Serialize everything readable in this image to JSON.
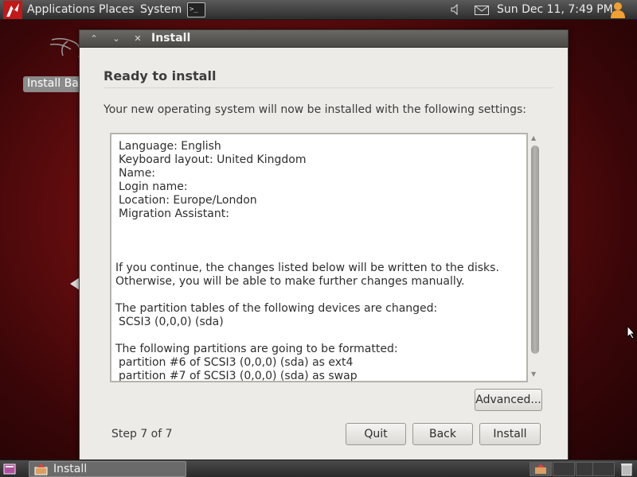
{
  "top_panel": {
    "menus": [
      "Applications",
      "Places",
      "System"
    ],
    "clock": "Sun Dec 11,  7:49 PM",
    "icons": [
      "kali-dragon-icon",
      "terminal-icon",
      "volume-icon",
      "mail-icon",
      "user-icon"
    ]
  },
  "desktop": {
    "icon_label": "Install Backtrack"
  },
  "window": {
    "title": "Install",
    "heading": "Ready to install",
    "intro": "Your new operating system will now be installed with the following settings:",
    "summary": {
      "settings": [
        "Language: English",
        "Keyboard layout: United Kingdom",
        "Name:",
        "Login name:",
        "Location: Europe/London",
        "Migration Assistant:"
      ],
      "notice": [
        "If you continue, the changes listed below will be written to the disks.",
        "Otherwise, you will be able to make further changes manually."
      ],
      "tables_heading": "The partition tables of the following devices are changed:",
      "tables": [
        "SCSI3 (0,0,0) (sda)"
      ],
      "format_heading": "The following partitions are going to be formatted:",
      "format": [
        "partition #6 of SCSI3 (0,0,0) (sda) as ext4",
        "partition #7 of SCSI3 (0,0,0) (sda) as swap"
      ]
    },
    "advanced_label": "Advanced...",
    "step": "Step 7 of 7",
    "quit_label": "Quit",
    "back_label": "Back",
    "install_label": "Install"
  },
  "bottom_panel": {
    "task_label": "Install"
  },
  "colors": {
    "desktop_red": "#8b1216",
    "window_bg": "#ecebe8",
    "titlebar": "#4a4945"
  }
}
